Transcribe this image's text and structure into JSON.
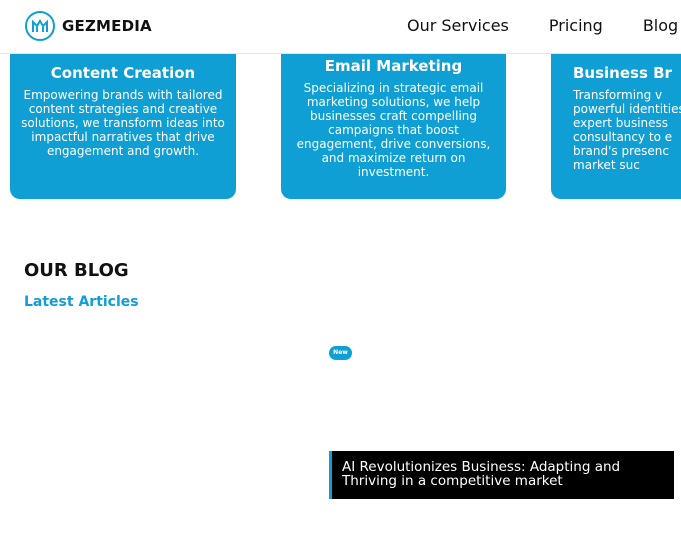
{
  "brand": {
    "name": "GEZMEDIA",
    "accent": "#0f9fd4"
  },
  "nav": {
    "items": [
      {
        "label": "Our Services"
      },
      {
        "label": "Pricing"
      },
      {
        "label": "Blog"
      }
    ]
  },
  "services": [
    {
      "title": "Content Creation",
      "description": "Empowering brands with tailored content strategies and creative solutions, we transform ideas into impactful narratives that drive engagement and growth."
    },
    {
      "title": "Email Marketing",
      "description": "Specializing in strategic email marketing solutions, we help businesses craft compelling campaigns that boost engagement, drive conversions, and maximize return on investment."
    },
    {
      "title": "Business Br",
      "description_lines": [
        "Transforming v",
        "powerful identities",
        "expert business",
        "consultancy to e",
        "brand's presenc",
        "market suc"
      ]
    }
  ],
  "blog": {
    "heading": "OUR BLOG",
    "subheading": "Latest Articles",
    "badge": "New",
    "article_title": "AI Revolutionizes Business: Adapting and Thriving in a competitive market"
  }
}
